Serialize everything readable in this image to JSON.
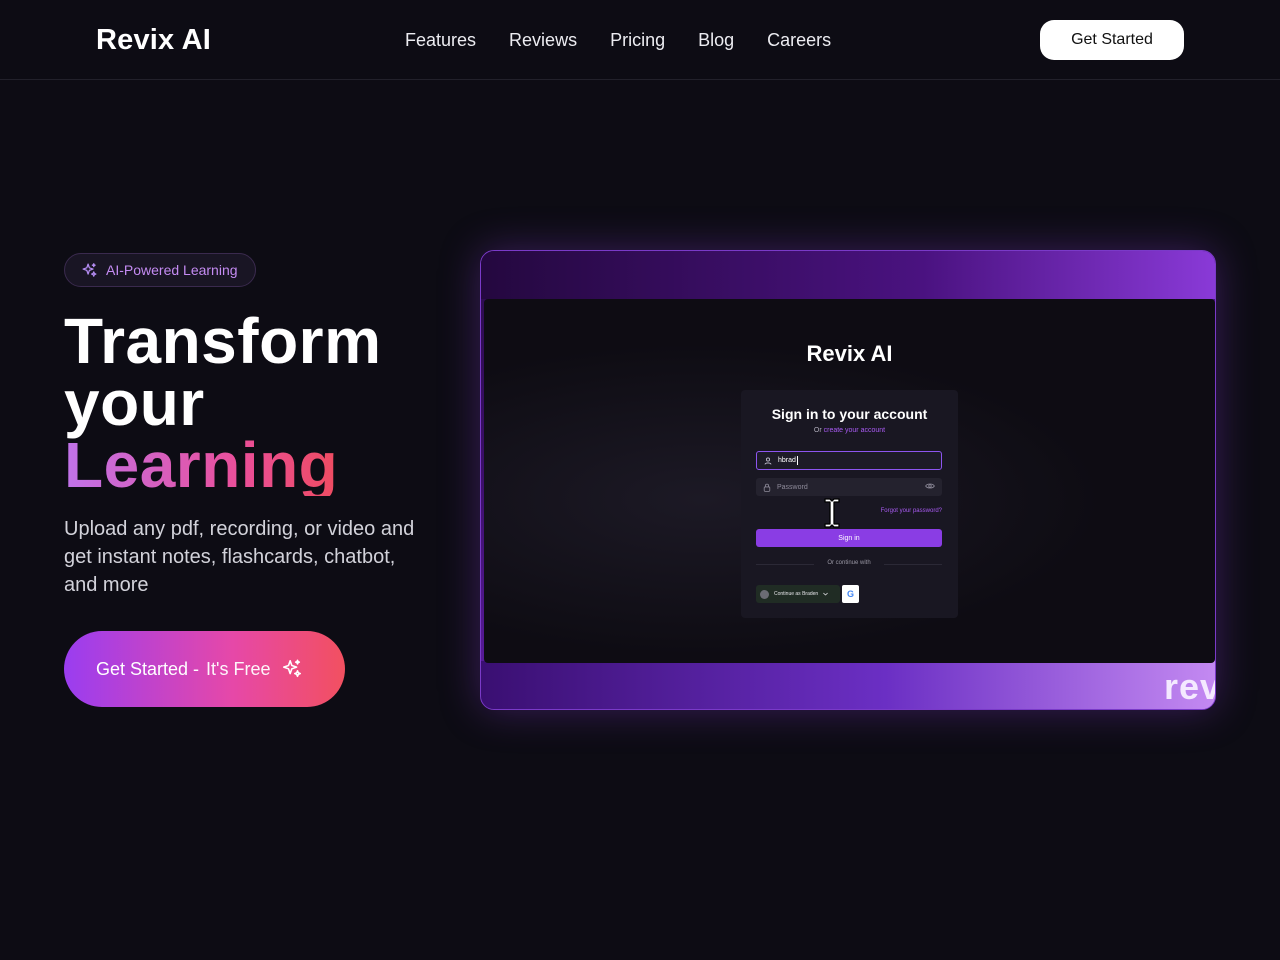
{
  "navbar": {
    "brand": "Revix AI",
    "links": [
      "Features",
      "Reviews",
      "Pricing",
      "Blog",
      "Careers"
    ],
    "cta": "Get Started"
  },
  "hero": {
    "badge": "AI-Powered Learning",
    "headline_line1": "Transform",
    "headline_line2": "your",
    "headline_line3": "Learning",
    "subtitle": "Upload any pdf, recording, or video and get instant notes, flashcards, chatbot, and more",
    "cta_main": "Get Started -",
    "cta_free": "It's Free"
  },
  "preview": {
    "app_brand": "Revix AI",
    "login": {
      "title": "Sign in to your account",
      "sub_prefix": "Or",
      "sub_link": "create your account",
      "username_value": "hbrad",
      "password_placeholder": "Password",
      "forgot": "Forgot your password?",
      "signin": "Sign in",
      "divider": "Or continue with",
      "continue_as": "Continue as Braden",
      "google_letter": "G"
    },
    "watermark": "rev"
  },
  "colors": {
    "background": "#0d0c14",
    "accent_purple": "#8a3de4",
    "gradient_start": "#c073ea",
    "gradient_end": "#f04a48"
  }
}
